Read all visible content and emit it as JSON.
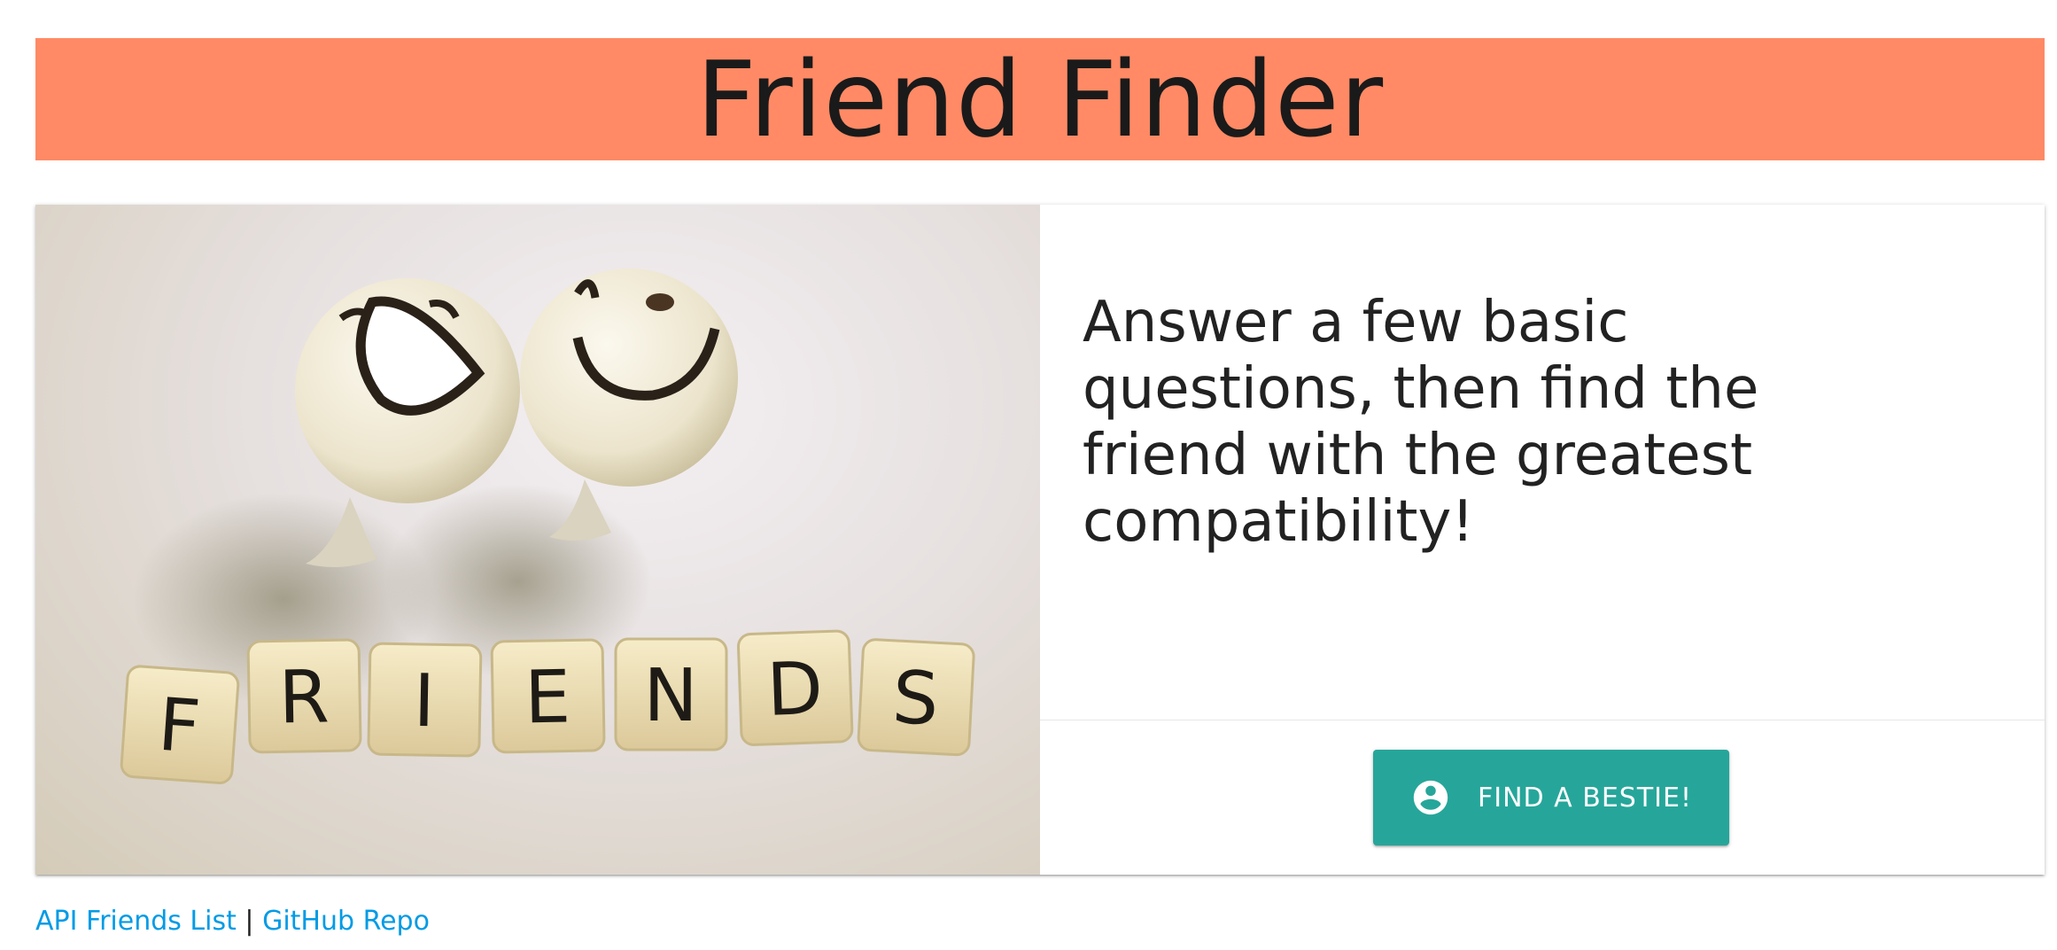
{
  "header": {
    "title": "Friend Finder"
  },
  "card": {
    "image_tiles": [
      "F",
      "R",
      "I",
      "E",
      "N",
      "D",
      "S"
    ],
    "description": "Answer a few basic questions, then find the friend with the greatest compatibility!",
    "action": {
      "label": "FIND A BESTIE!",
      "icon": "account-circle-icon"
    }
  },
  "footer": {
    "api_link": "API Friends List",
    "separator": "|",
    "github_link": "GitHub Repo"
  },
  "colors": {
    "header_bg": "#ff8a65",
    "button_bg": "#26a69a",
    "link": "#039be5"
  }
}
